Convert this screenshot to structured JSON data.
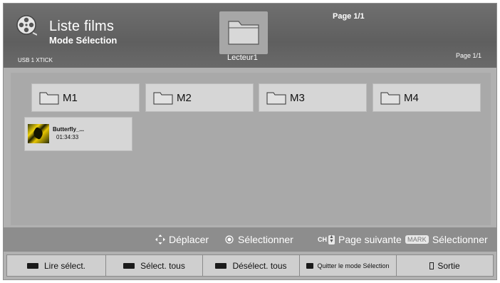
{
  "header": {
    "app_title": "Liste films",
    "mode": "Mode Sélection",
    "device": "USB 1 XTICK",
    "drive_label": "Lecteur1",
    "page_top": "Page 1/1",
    "page_right": "Page 1/1"
  },
  "folders": [
    {
      "label": "M1"
    },
    {
      "label": "M2"
    },
    {
      "label": "M3"
    },
    {
      "label": "M4"
    }
  ],
  "files": [
    {
      "name": "Butterfly_...",
      "duration": "01:34:33"
    }
  ],
  "hints": {
    "move": "Déplacer",
    "select": "Sélectionner",
    "ch_key": "CH",
    "next_page": "Page suivante",
    "mark_key": "MARK",
    "mark_select": "Sélectionner"
  },
  "buttons": {
    "play_selected": "Lire sélect.",
    "select_all": "Sélect. tous",
    "deselect_all": "Désélect. tous",
    "quit_selection": "Quitter le mode Sélection",
    "exit": "Sortie"
  },
  "colors": {
    "background": "#b1b1b1",
    "header": "#666666",
    "tile": "#d6d6d6",
    "button": "#cfcfcf"
  }
}
